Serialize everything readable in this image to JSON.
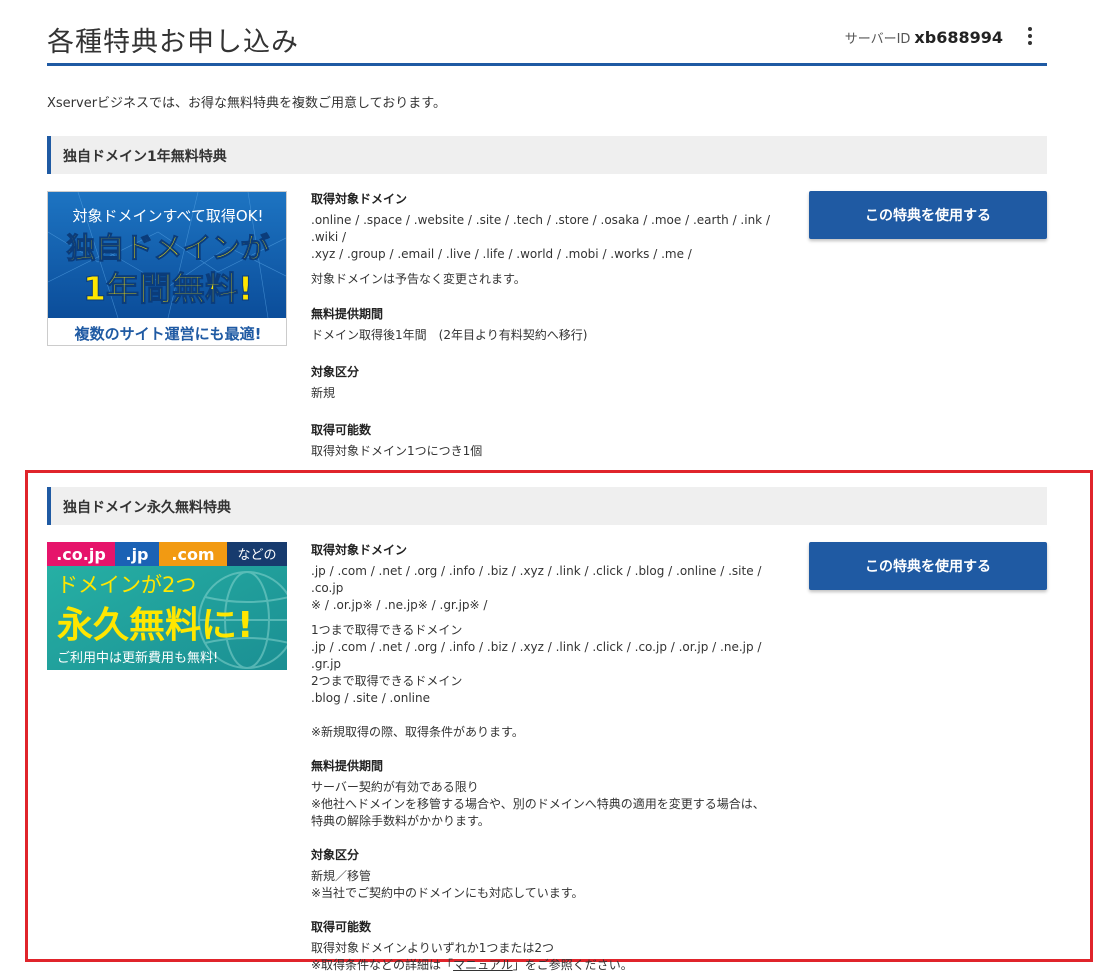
{
  "header": {
    "title": "各種特典お申し込み",
    "server_id_label": "サーバーID",
    "server_id": "xb688994"
  },
  "intro": "Xserverビジネスでは、お得な無料特典を複数ご用意しております。",
  "colors": {
    "accent": "#1f5aa3",
    "highlight": "#e0242b",
    "section_bg": "#efefef"
  },
  "offers": [
    {
      "title": "独自ドメイン1年無料特典",
      "banner": {
        "line1": "対象ドメインすべて取得OK!",
        "line2": "独自ドメインが",
        "line3": "1年間無料!",
        "line4": "複数のサイト運営にも最適!"
      },
      "domains_label": "取得対象ドメイン",
      "domains": ".online / .space / .website / .site / .tech / .store / .osaka / .moe / .earth / .ink / .wiki /\n.xyz / .group / .email / .live / .life / .world / .mobi / .works / .me /",
      "domains_note": "対象ドメインは予告なく変更されます。",
      "period_label": "無料提供期間",
      "period": "ドメイン取得後1年間　(2年目より有料契約へ移行)",
      "category_label": "対象区分",
      "category": "新規",
      "count_label": "取得可能数",
      "count": "取得対象ドメイン1つにつき1個",
      "button": "この特典を使用する"
    },
    {
      "title": "独自ドメイン永久無料特典",
      "banner": {
        "tag1": ".co.jp",
        "tag2": ".jp",
        "tag3": ".com",
        "tag4": "などの",
        "line1": "ドメインが2つ",
        "line2": "永久無料に!",
        "line3": "ご利用中は更新費用も無料!"
      },
      "domains_label": "取得対象ドメイン",
      "domains": ".jp / .com / .net / .org / .info / .biz / .xyz / .link / .click / .blog / .online / .site / .co.jp\n※ / .or.jp※ / .ne.jp※ / .gr.jp※ /",
      "domains_detail": "1つまで取得できるドメイン\n.jp / .com / .net / .org / .info / .biz / .xyz / .link / .click / .co.jp / .or.jp / .ne.jp / .gr.jp\n2つまで取得できるドメイン\n.blog / .site / .online",
      "domains_note": "※新規取得の際、取得条件があります。",
      "period_label": "無料提供期間",
      "period": "サーバー契約が有効である限り\n※他社へドメインを移管する場合や、別のドメインへ特典の適用を変更する場合は、\n特典の解除手数料がかかります。",
      "category_label": "対象区分",
      "category": "新規／移管\n※当社でご契約中のドメインにも対応しています。",
      "count_label": "取得可能数",
      "count": "取得対象ドメインよりいずれか1つまたは2つ",
      "count_note_pre": "※取得条件などの詳細は「",
      "count_note_link": "マニュアル",
      "count_note_post": "」をご参照ください。",
      "button": "この特典を使用する"
    }
  ]
}
